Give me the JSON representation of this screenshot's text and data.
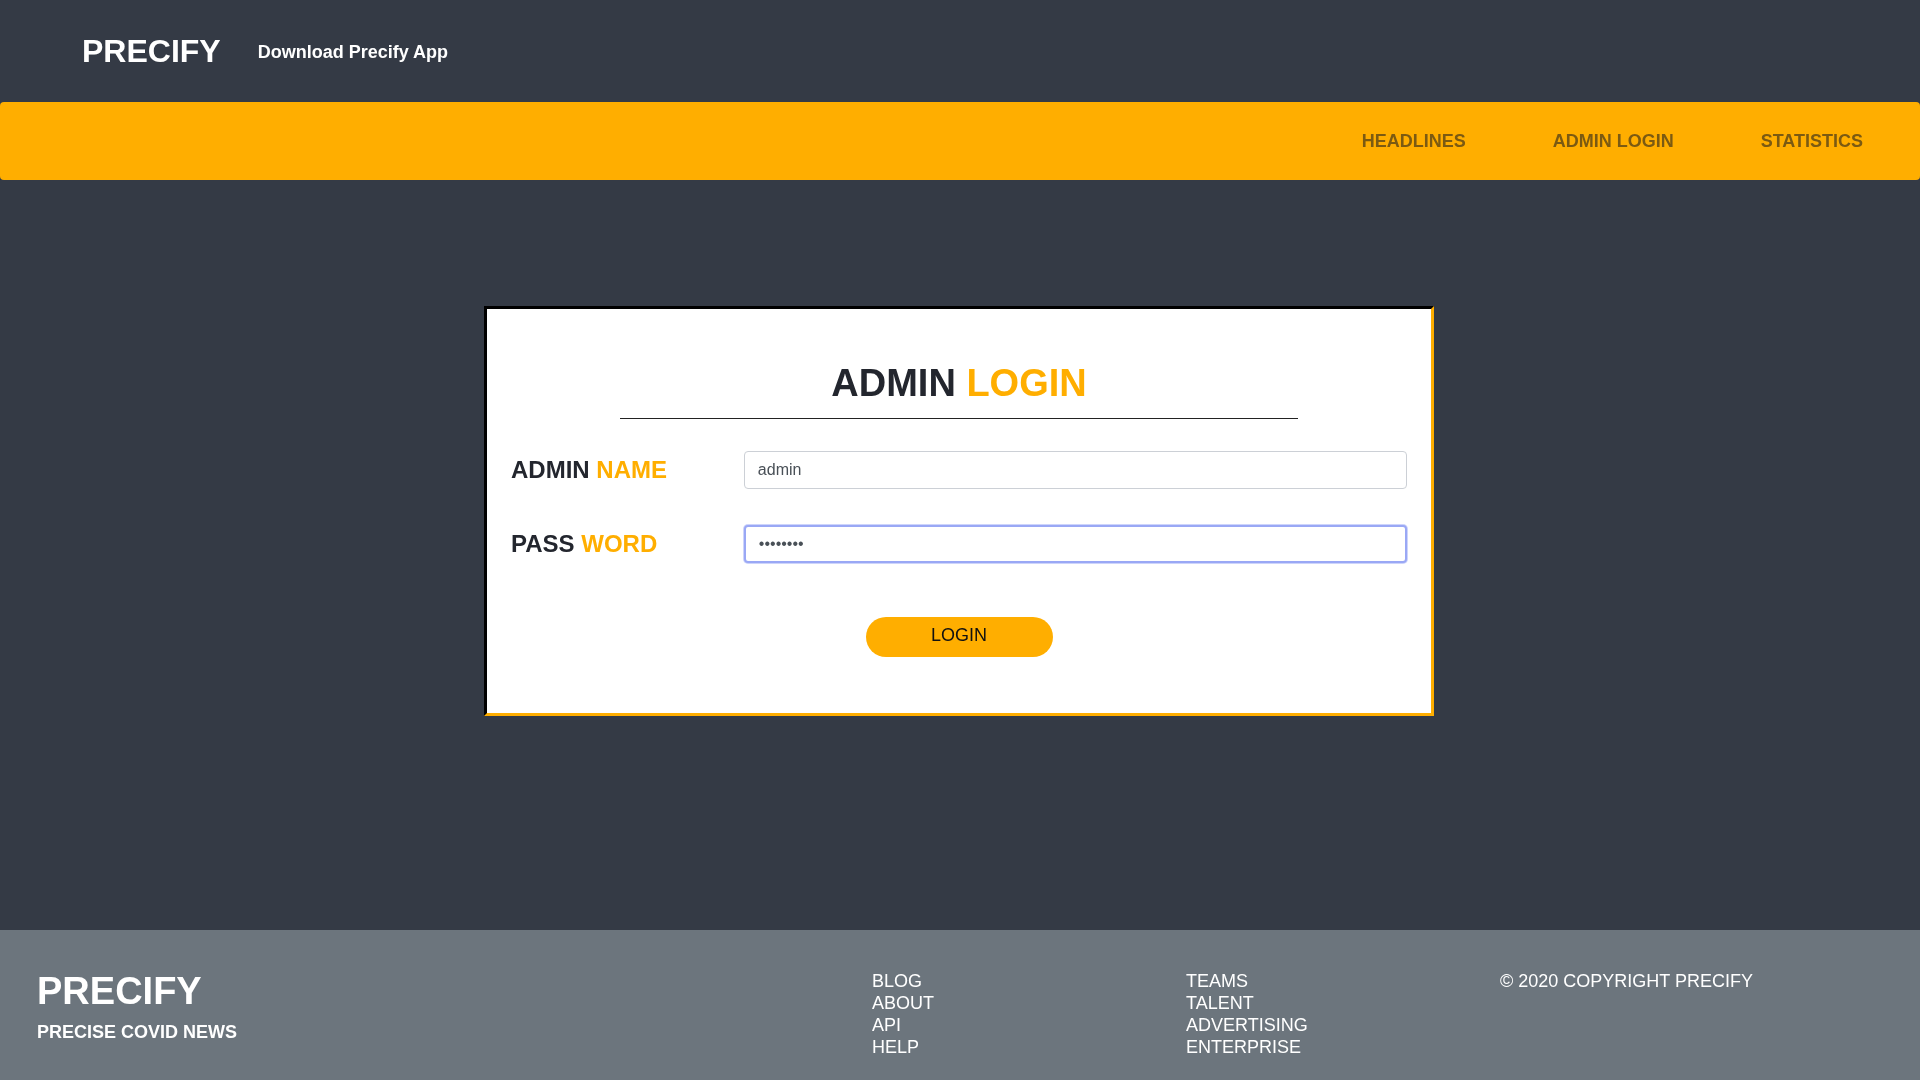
{
  "header": {
    "brand": "PRECIFY",
    "link": "Download Precify App"
  },
  "nav": {
    "items": [
      {
        "label": "HEADLINES",
        "selected": false
      },
      {
        "label": "ADMIN LOGIN",
        "selected": false
      },
      {
        "label": "STATISTICS",
        "selected": false
      }
    ]
  },
  "login": {
    "title": {
      "dark": "ADMIN",
      "accent": "LOGIN"
    },
    "fields": [
      {
        "label_dark": "ADMIN",
        "label_accent": "NAME",
        "value": "admin",
        "focused": false
      },
      {
        "label_dark": "PASS",
        "label_accent": "WORD",
        "value": "••••••••",
        "focused": true
      }
    ],
    "button": "LOGIN"
  },
  "footer": {
    "brand": "PRECIFY",
    "tagline": "PRECISE COVID NEWS",
    "columns": [
      [
        "BLOG",
        "ABOUT",
        "API",
        "HELP"
      ],
      [
        "TEAMS",
        "TALENT",
        "ADVERTISING",
        "ENTERPRISE"
      ]
    ],
    "copyright": "© 2020 COPYRIGHT PRECIFY"
  }
}
